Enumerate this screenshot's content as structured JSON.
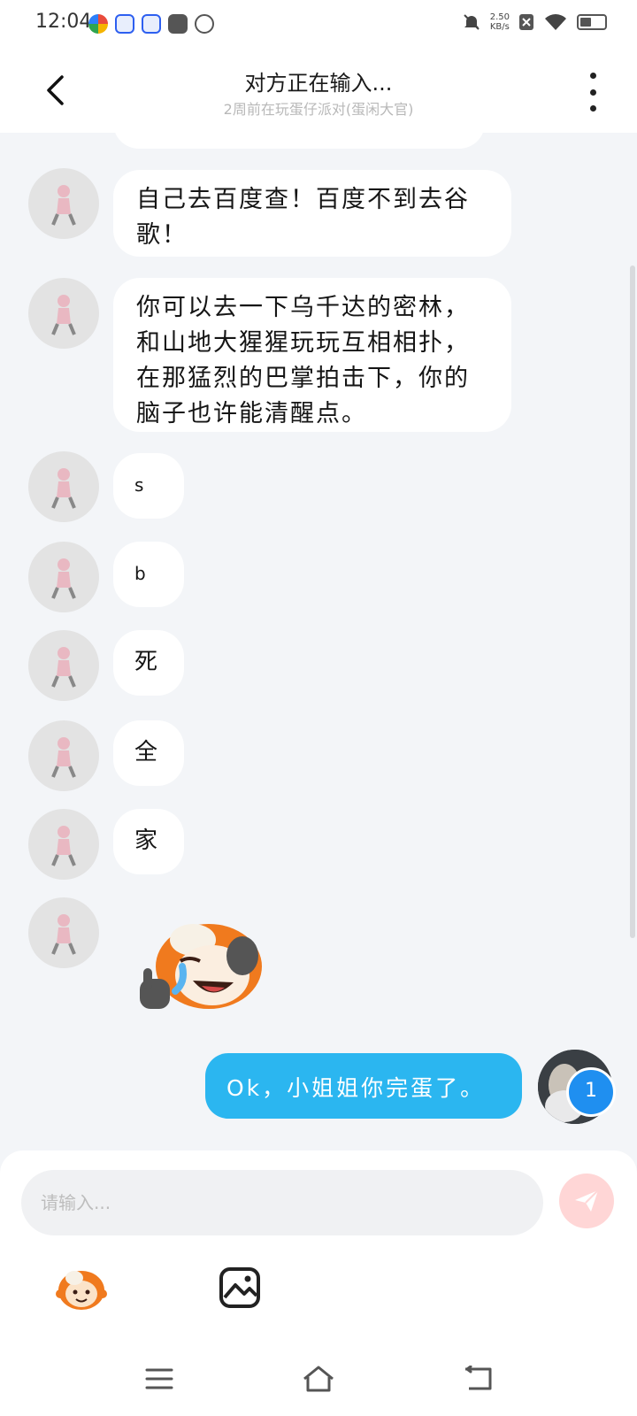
{
  "status_bar": {
    "time": "12:04",
    "net_speed_value": "2.50",
    "net_speed_unit": "KB/s"
  },
  "header": {
    "title": "对方正在输入...",
    "subtitle": "2周前在玩蛋仔派对(蛋闲大官)"
  },
  "messages": [
    {
      "from": "other",
      "text": "自己去百度查！百度不到去谷歌！"
    },
    {
      "from": "other",
      "text": "你可以去一下乌千达的密林，和山地大猩猩玩玩互相相扑，在那猛烈的巴掌拍击下，你的脑子也许能清醒点。"
    },
    {
      "from": "other",
      "text": "s"
    },
    {
      "from": "other",
      "text": "b"
    },
    {
      "from": "other",
      "text": "死"
    },
    {
      "from": "other",
      "text": "全"
    },
    {
      "from": "other",
      "text": "家"
    },
    {
      "from": "other",
      "type": "sticker",
      "icon": "crying-laughing-monkey-sticker"
    },
    {
      "from": "me",
      "text": "Ok，小姐姐你完蛋了。",
      "badge": "1"
    }
  ],
  "input": {
    "placeholder": "请输入..."
  },
  "colors": {
    "my_bubble": "#2bb6f0",
    "background": "#f3f5f8",
    "send_button": "#ffd6d6"
  }
}
